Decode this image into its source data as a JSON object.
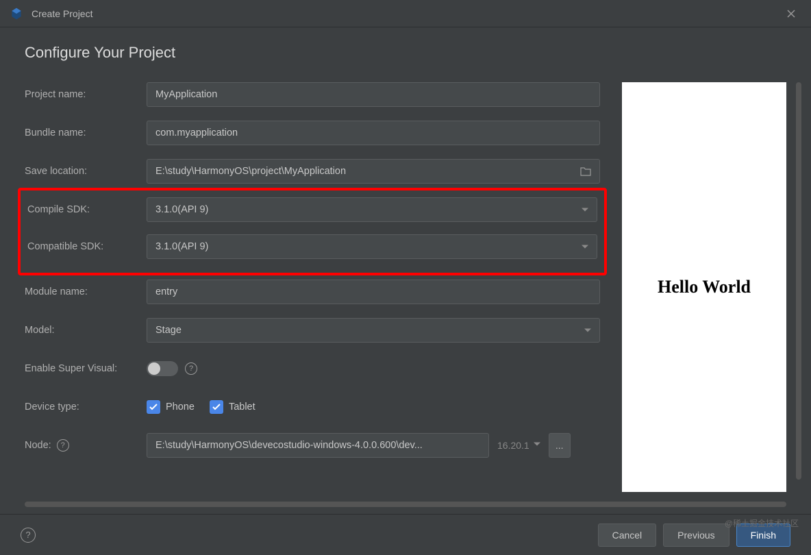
{
  "window": {
    "title": "Create Project"
  },
  "header": {
    "title": "Configure Your Project"
  },
  "form": {
    "projectName": {
      "label": "Project name:",
      "value": "MyApplication"
    },
    "bundleName": {
      "label": "Bundle name:",
      "value": "com.myapplication"
    },
    "saveLocation": {
      "label": "Save location:",
      "value": "E:\\study\\HarmonyOS\\project\\MyApplication"
    },
    "compileSdk": {
      "label": "Compile SDK:",
      "value": "3.1.0(API 9)"
    },
    "compatibleSdk": {
      "label": "Compatible SDK:",
      "value": "3.1.0(API 9)"
    },
    "moduleName": {
      "label": "Module name:",
      "value": "entry"
    },
    "model": {
      "label": "Model:",
      "value": "Stage"
    },
    "enableSuperVisual": {
      "label": "Enable Super Visual:"
    },
    "deviceType": {
      "label": "Device type:",
      "options": {
        "phone": "Phone",
        "tablet": "Tablet"
      }
    },
    "node": {
      "label": "Node:",
      "value": "E:\\study\\HarmonyOS\\devecostudio-windows-4.0.0.600\\dev...",
      "version": "16.20.1"
    }
  },
  "preview": {
    "text": "Hello World"
  },
  "footer": {
    "cancel": "Cancel",
    "previous": "Previous",
    "finish": "Finish"
  },
  "watermark": "@稀土掘金技术社区"
}
